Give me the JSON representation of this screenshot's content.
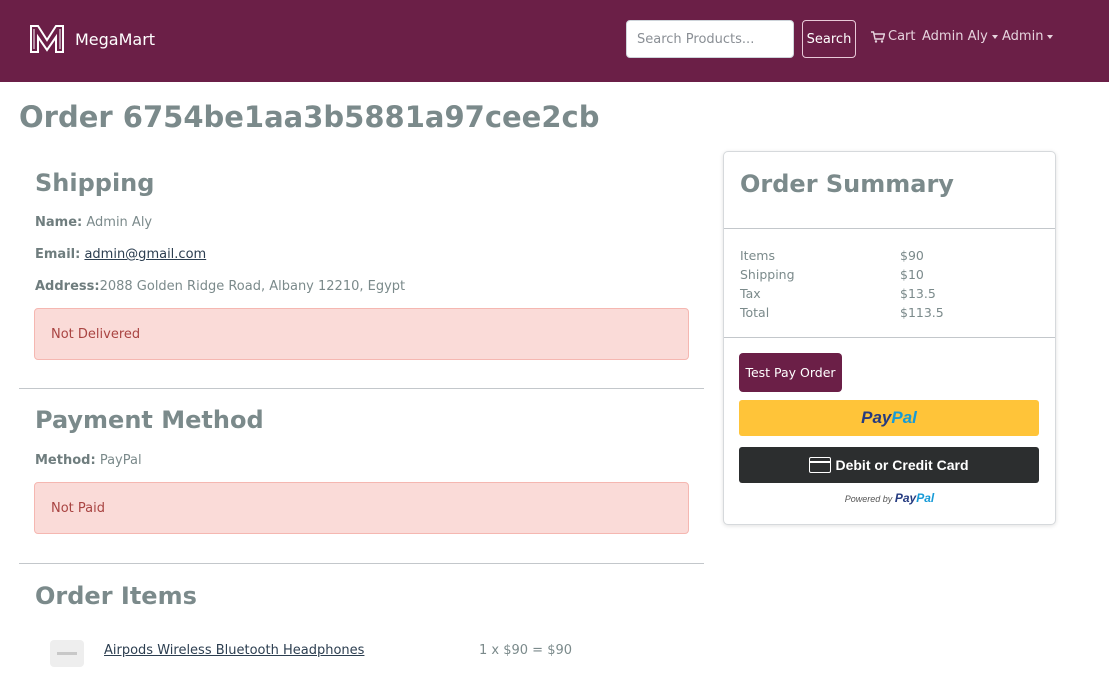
{
  "header": {
    "brand": "MegaMart",
    "search_placeholder": "Search Products...",
    "search_button": "Search",
    "cart_label": "Cart",
    "user_menu": "Admin Aly",
    "admin_menu": "Admin"
  },
  "page": {
    "title": "Order 6754be1aa3b5881a97cee2cb"
  },
  "shipping": {
    "title": "Shipping",
    "name_label": "Name:",
    "name_value": "Admin Aly",
    "email_label": "Email:",
    "email_value": "admin@gmail.com",
    "address_label": "Address:",
    "address_value": "2088 Golden Ridge Road, Albany 12210, Egypt",
    "status": "Not Delivered"
  },
  "payment": {
    "title": "Payment Method",
    "method_label": "Method:",
    "method_value": "PayPal",
    "status": "Not Paid"
  },
  "order_items": {
    "title": "Order Items",
    "items": [
      {
        "name": "Airpods Wireless Bluetooth Headphones",
        "price_line": "1 x $90 = $90"
      }
    ]
  },
  "summary": {
    "title": "Order Summary",
    "rows": [
      {
        "label": "Items",
        "value": "$90"
      },
      {
        "label": "Shipping",
        "value": "$10"
      },
      {
        "label": "Tax",
        "value": "$13.5"
      },
      {
        "label": "Total",
        "value": "$113.5"
      }
    ],
    "test_pay_button": "Test Pay Order",
    "paypal_button_part1": "Pay",
    "paypal_button_part2": "Pal",
    "card_button": "Debit or Credit Card",
    "powered_by": "Powered by",
    "powered_brand_part1": "Pay",
    "powered_brand_part2": "Pal"
  },
  "colors": {
    "navbar": "#6b1f47",
    "alert_bg": "#fadbd8",
    "alert_text": "#a94442",
    "paypal_yellow": "#ffc439",
    "card_dark": "#2c2e2f"
  }
}
